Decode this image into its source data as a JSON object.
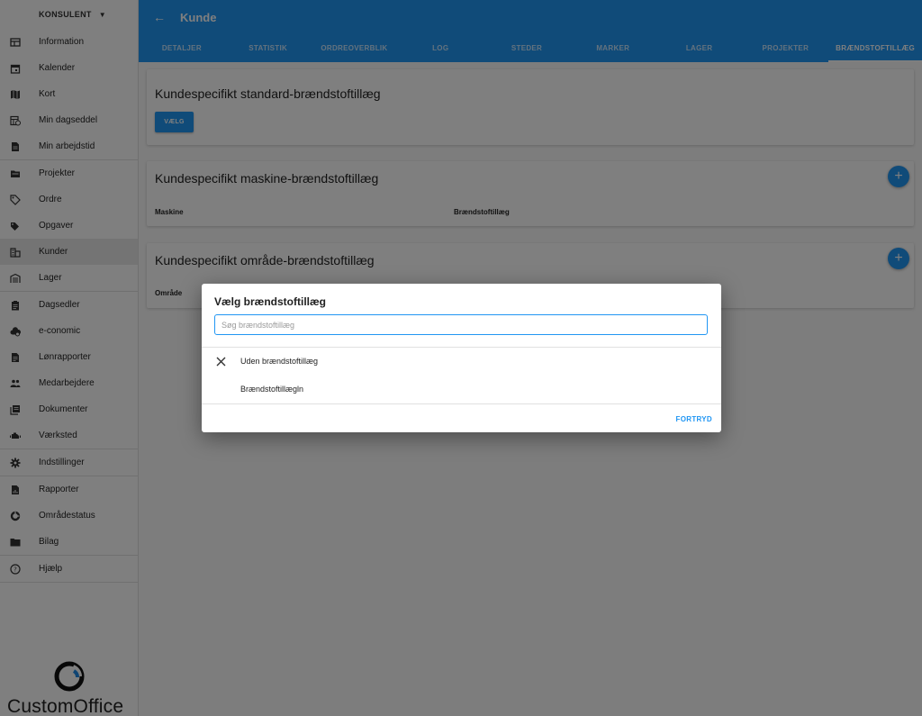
{
  "sidebar": {
    "role": "KONSULENT",
    "groups": [
      [
        {
          "label": "Information",
          "icon": "table-icon"
        },
        {
          "label": "Kalender",
          "icon": "calendar-icon"
        },
        {
          "label": "Kort",
          "icon": "map-icon"
        },
        {
          "label": "Min dagseddel",
          "icon": "timesheet-icon"
        },
        {
          "label": "Min arbejdstid",
          "icon": "document-icon"
        }
      ],
      [
        {
          "label": "Projekter",
          "icon": "folder-icon"
        },
        {
          "label": "Ordre",
          "icon": "tag-icon"
        },
        {
          "label": "Opgaver",
          "icon": "tags-icon"
        },
        {
          "label": "Kunder",
          "icon": "business-icon",
          "active": true
        },
        {
          "label": "Lager",
          "icon": "warehouse-icon"
        }
      ],
      [
        {
          "label": "Dagsedler",
          "icon": "clipboard-icon"
        },
        {
          "label": "e-conomic",
          "icon": "cloud-icon"
        },
        {
          "label": "Lønrapporter",
          "icon": "report-icon"
        },
        {
          "label": "Medarbejdere",
          "icon": "people-icon"
        },
        {
          "label": "Dokumenter",
          "icon": "library-icon"
        },
        {
          "label": "Værksted",
          "icon": "engine-icon"
        }
      ],
      [
        {
          "label": "Indstillinger",
          "icon": "gear-icon"
        }
      ],
      [
        {
          "label": "Rapporter",
          "icon": "chart-file-icon"
        },
        {
          "label": "Områdestatus",
          "icon": "donut-icon"
        },
        {
          "label": "Bilag",
          "icon": "folder-open-icon"
        }
      ],
      [
        {
          "label": "Hjælp",
          "icon": "help-icon"
        }
      ]
    ],
    "logo_text": "CustomOffice"
  },
  "header": {
    "title": "Kunde",
    "tabs": [
      {
        "label": "DETALJER"
      },
      {
        "label": "STATISTIK"
      },
      {
        "label": "ORDREOVERBLIK"
      },
      {
        "label": "LOG"
      },
      {
        "label": "STEDER"
      },
      {
        "label": "MARKER"
      },
      {
        "label": "LAGER"
      },
      {
        "label": "PROJEKTER"
      },
      {
        "label": "BRÆNDSTOFTILLÆG",
        "active": true
      }
    ]
  },
  "cards": {
    "standard": {
      "title": "Kundespecifikt standard-brændstoftillæg",
      "button": "VÆLG"
    },
    "machine": {
      "title": "Kundespecifikt maskine-brændstoftillæg",
      "col1": "Maskine",
      "col2": "Brændstoftillæg",
      "fab": "+"
    },
    "area": {
      "title": "Kundespecifikt område-brændstoftillæg",
      "col1": "Område",
      "fab": "+"
    }
  },
  "dialog": {
    "title": "Vælg brændstoftillæg",
    "search_placeholder": "Søg brændstoftillæg",
    "search_value": "",
    "options": [
      {
        "label": "Uden brændstoftillæg",
        "icon": "close-icon"
      },
      {
        "label": "Brændstoftillægln",
        "icon": ""
      }
    ],
    "cancel": "FORTRYD"
  },
  "colors": {
    "primary": "#2196f3",
    "overlay": "rgba(0,0,0,0.5)"
  }
}
